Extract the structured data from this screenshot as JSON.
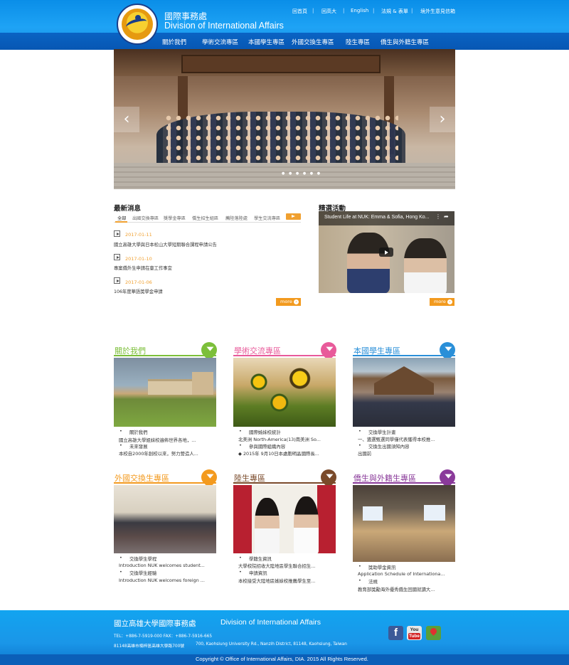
{
  "header": {
    "title_cn": "國際事務處",
    "title_en": "Division of International Affairs",
    "top_links": [
      "回首頁",
      "回高大",
      "English",
      "法規 & 表單",
      "境外生意見信箱"
    ],
    "nav": [
      "關於我們",
      "學術交流專區",
      "本國學生專區",
      "外國交換生專區",
      "陸生專區",
      "僑生與外籍生專區"
    ]
  },
  "hero": {
    "prev_icon": "‹",
    "next_icon": "›",
    "dots": "● ● ● ● ● ●"
  },
  "news": {
    "title": "最新消息",
    "tabs": [
      "全部",
      "出國交換專區",
      "獎學金專區",
      "僑生招生組區",
      "薦陸落陸處",
      "學生交流專區"
    ],
    "items": [
      {
        "date": "2017-01-11",
        "text": "國立高雄大學與日本松山大學短期聯合課程申請公告"
      },
      {
        "date": "2017-01-10",
        "text": "專案僑外生申請在臺工作事宜"
      },
      {
        "date": "2017-01-06",
        "text": "106年度華語獎學金申請"
      }
    ],
    "more_label": "more"
  },
  "featured": {
    "title": "精選活動",
    "video_title": "Student Life at NUK: Emma & Sofia, Hong Ko...",
    "more_label": "more"
  },
  "cards": [
    {
      "title": "關於我們",
      "color": "#7cbf3a",
      "lines": [
        {
          "bullet": true,
          "text": "關於我們"
        },
        {
          "bullet": false,
          "text": "國立高雄大學姐妹校遍佈世界各地，..."
        },
        {
          "bullet": true,
          "text": "未來發展"
        },
        {
          "bullet": false,
          "text": "本校自2000年創校以來，努力營造人..."
        }
      ]
    },
    {
      "title": "學術交流專區",
      "color": "#e85a9a",
      "lines": [
        {
          "bullet": true,
          "text": "國際姊妹校統計"
        },
        {
          "bullet": false,
          "text": "北美洲 North-America(13)南美洲 So..."
        },
        {
          "bullet": true,
          "text": "參與國際組織內容"
        },
        {
          "bullet": false,
          "text": "◆ 2015年 9月10日本處胞明晶國際長..."
        }
      ]
    },
    {
      "title": "本國學生專區",
      "color": "#2a8fd8",
      "lines": [
        {
          "bullet": true,
          "text": "交換學生計畫"
        },
        {
          "bullet": false,
          "text": "一、遴選甄選同學僅代表獲得本校推..."
        },
        {
          "bullet": true,
          "text": "交換生出國須知內容"
        },
        {
          "bullet": false,
          "text": "出國前"
        }
      ]
    },
    {
      "title": "外國交換生專區",
      "color": "#f39a1e",
      "lines": [
        {
          "bullet": true,
          "text": "交換學生學程"
        },
        {
          "bullet": false,
          "text": "Introduction  NUK welcomes student..."
        },
        {
          "bullet": true,
          "text": "交換學生經驗"
        },
        {
          "bullet": false,
          "text": "Introduction  NUK welcomes foreign ..."
        }
      ]
    },
    {
      "title": "陸生專區",
      "color": "#7a4a2a",
      "lines": [
        {
          "bullet": true,
          "text": "學籍生資訊"
        },
        {
          "bullet": false,
          "text": "大學校院招收大陸地區學生聯合招生..."
        },
        {
          "bullet": true,
          "text": "申請資訊"
        },
        {
          "bullet": false,
          "text": "本校接受大陸地區姊妹校推薦學生至..."
        }
      ]
    },
    {
      "title": "僑生與外籍生專區",
      "color": "#8a3a9a",
      "lines": [
        {
          "bullet": true,
          "text": "獎助學金資訊"
        },
        {
          "bullet": false,
          "text": "Application Schedule of Internationa..."
        },
        {
          "bullet": true,
          "text": "法規"
        },
        {
          "bullet": false,
          "text": "教育部獎勵海外優秀僑生回國就讀大..."
        }
      ]
    }
  ],
  "footer": {
    "name_cn": "國立高雄大學國際事務處",
    "name_en": "Division of International Affairs",
    "tel": "TEL：+886-7-5919-000    FAX：+886-7-5916-665",
    "addr_cn": "81148高雄市楠梓區高雄大學路700號",
    "addr_en": "700, Kaohsiung University Rd., Nanzih District, 81148, Kaohsiung, Taiwan",
    "copyright": "Copyright © Office of International Affairs, DIA. 2015 All Rights Reserved.",
    "social": {
      "facebook": "f",
      "youtube_top": "You",
      "youtube_bottom": "Tube"
    }
  }
}
